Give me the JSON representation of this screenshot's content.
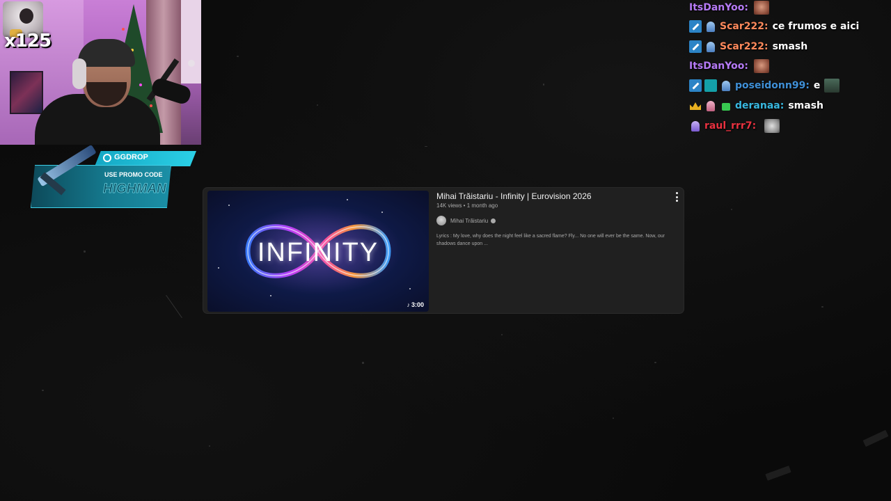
{
  "webcam": {
    "multiplier": "x125"
  },
  "promo": {
    "brand": "GGDROP",
    "cta": "USE PROMO CODE",
    "code": "HIGHMAN"
  },
  "chat": {
    "messages": [
      {
        "user": "ItsDanYoo:",
        "user_color": "#b57af5",
        "text": "",
        "badges": [],
        "emote": "face-emote"
      },
      {
        "user": "Scar222:",
        "user_color": "#ff8a5c",
        "text": "ce frumos e aici",
        "badges": [
          "mod-badge",
          "sub-badge"
        ],
        "emote": ""
      },
      {
        "user": "Scar222:",
        "user_color": "#ff8a5c",
        "text": "smash",
        "badges": [
          "mod-badge",
          "sub-badge"
        ],
        "emote": ""
      },
      {
        "user": "ItsDanYoo:",
        "user_color": "#b57af5",
        "text": "",
        "badges": [],
        "emote": "face-emote"
      },
      {
        "user": "poseidonn99:",
        "user_color": "#3f8fd6",
        "text": "e",
        "badges": [
          "mod-badge",
          "og-badge",
          "sub-badge"
        ],
        "emote": "real-emote"
      },
      {
        "user": "deranaa:",
        "user_color": "#38b8e0",
        "text": "smash",
        "badges": [
          "crown-badge",
          "sub-badge-pink",
          "gift-badge"
        ],
        "emote": ""
      },
      {
        "user": "raul_rrr7:",
        "user_color": "#e8313f",
        "text": "",
        "badges": [
          "sub-badge-purple"
        ],
        "emote": "grey-emote"
      }
    ]
  },
  "video": {
    "thumbnail_text": "INFINITY",
    "duration": "3:00",
    "title": "Mihai Trăistariu - Infinity | Eurovision 2026",
    "meta": "14K views • 1 month ago",
    "channel": "Mihai Trăistariu",
    "description": "Lyrics : My love, why does the night feel like a sacred flame? Fly... No one will ever be the same. Now, our shadows dance upon ..."
  },
  "colors": {
    "background": "#0a0a0a",
    "card": "#202020",
    "promo_accent": "#2bd0e6"
  }
}
